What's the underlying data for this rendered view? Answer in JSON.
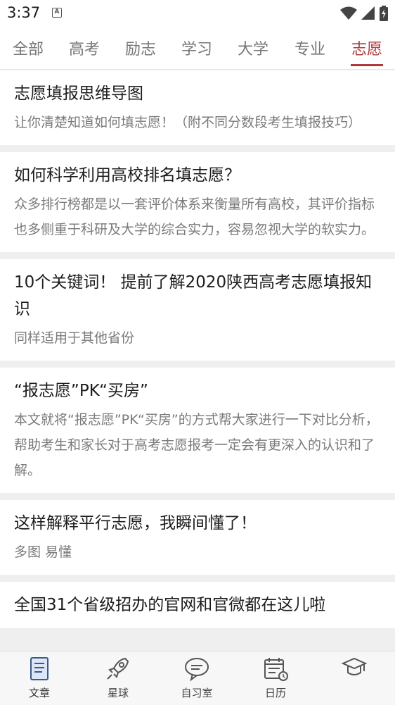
{
  "status_bar": {
    "time": "3:37",
    "notif_letter": "A"
  },
  "tabs": [
    {
      "label": "全部"
    },
    {
      "label": "高考"
    },
    {
      "label": "励志"
    },
    {
      "label": "学习"
    },
    {
      "label": "大学"
    },
    {
      "label": "专业"
    },
    {
      "label": "志愿",
      "active": true
    }
  ],
  "articles": [
    {
      "title": "志愿填报思维导图",
      "summary": "让你清楚知道如何填志愿！（附不同分数段考生填报技巧）"
    },
    {
      "title": "如何科学利用高校排名填志愿？",
      "summary": "众多排行榜都是以一套评价体系来衡量所有高校，其评价指标也多侧重于科研及大学的综合实力，容易忽视大学的软实力。"
    },
    {
      "title": "10个关键词！ 提前了解2020陕西高考志愿填报知识",
      "summary": "同样适用于其他省份"
    },
    {
      "title": "“报志愿”PK“买房”",
      "summary": "本文就将“报志愿”PK“买房”的方式帮大家进行一下对比分析，帮助考生和家长对于高考志愿报考一定会有更深入的认识和了解。"
    },
    {
      "title": "这样解释平行志愿，我瞬间懂了！",
      "summary": "多图 易懂"
    },
    {
      "title": "全国31个省级招办的官网和官微都在这儿啦",
      "summary": ""
    }
  ],
  "bottom_nav": [
    {
      "label": "文章",
      "icon": "article-icon",
      "active": true
    },
    {
      "label": "星球",
      "icon": "rocket-icon"
    },
    {
      "label": "自习室",
      "icon": "chat-icon"
    },
    {
      "label": "日历",
      "icon": "calendar-icon"
    },
    {
      "label": "",
      "icon": "graduate-icon"
    }
  ],
  "colors": {
    "accent": "#b03a3a",
    "tab_inactive": "#777777",
    "summary_text": "#7a7a7a"
  }
}
